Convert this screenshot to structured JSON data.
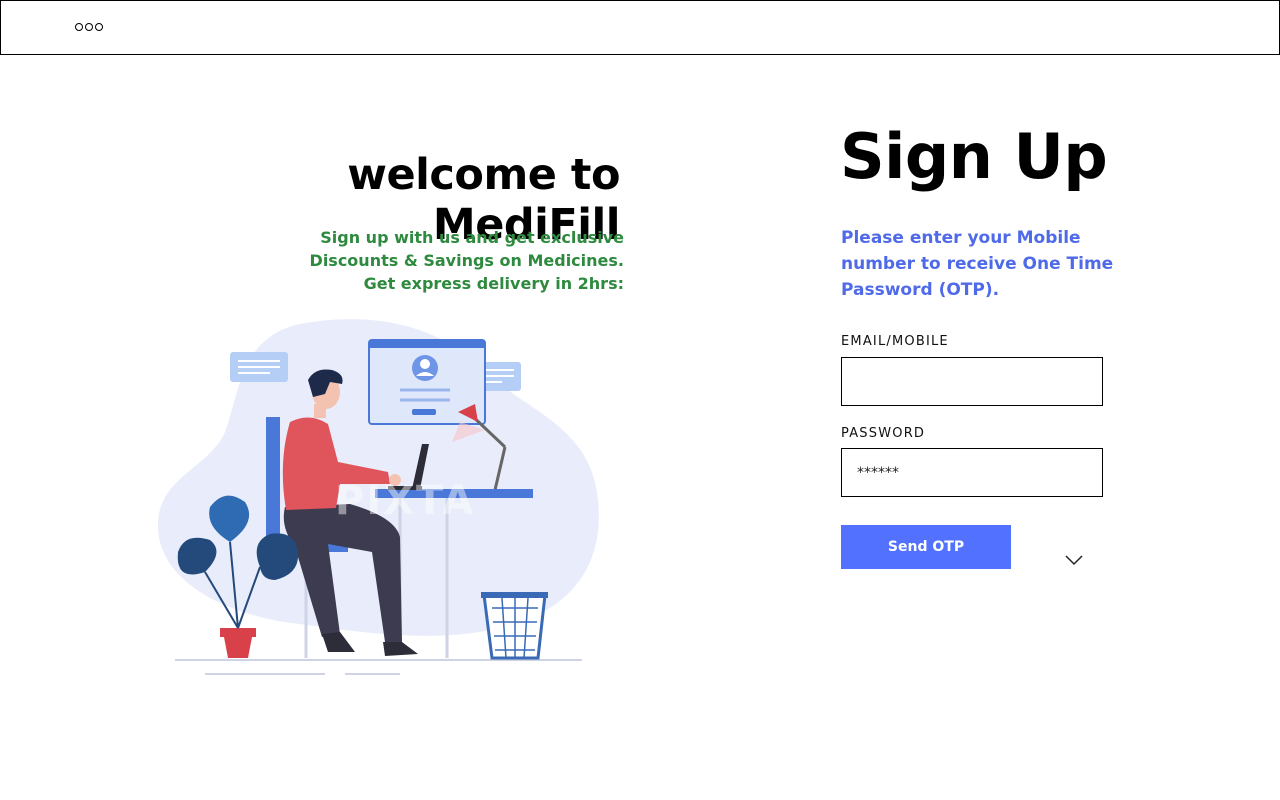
{
  "header": {
    "menu_icon": "more-horizontal-icon"
  },
  "welcome": {
    "title": "welcome to MediFill",
    "promo_lines": [
      "Sign up with us and get exclusive",
      "Discounts & Savings on Medicines.",
      "Get express delivery in 2hrs:"
    ],
    "illustration_watermark": "PIXTA"
  },
  "signup": {
    "title": "Sign Up",
    "subtitle": "Please enter your Mobile number to receive One Time Password (OTP).",
    "email_label": "EMAIL/MOBILE",
    "email_value": "",
    "password_label": "PASSWORD",
    "password_value": "******",
    "send_button": "Send OTP",
    "dropdown_icon": "chevron-down-icon"
  },
  "colors": {
    "accent": "#5271ff",
    "subtitle": "#4f6ae8",
    "promo": "#2e8a3e"
  }
}
